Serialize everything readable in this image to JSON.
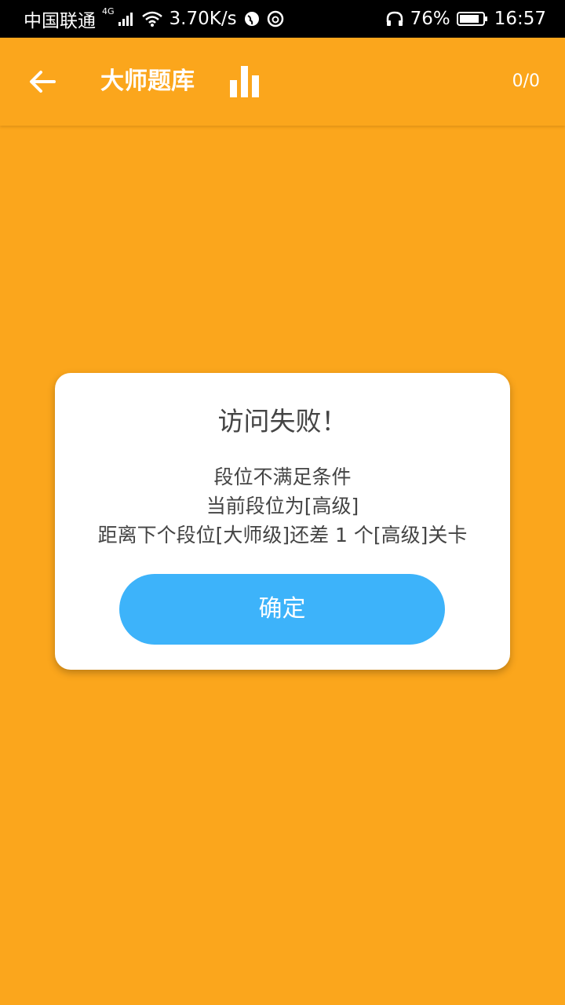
{
  "status_bar": {
    "carrier": "中国联通",
    "network": "4G",
    "speed": "3.70K/s",
    "battery": "76%",
    "time": "16:57"
  },
  "app_bar": {
    "title": "大师题库",
    "progress": "0/0"
  },
  "dialog": {
    "title": "访问失败！",
    "lines": [
      "段位不满足条件",
      "当前段位为[高级]",
      "距离下个段位[大师级]还差 1 个[高级]关卡"
    ],
    "confirm_label": "确定"
  },
  "colors": {
    "background": "#FBA61C",
    "button": "#3DB3FA",
    "dialog_bg": "#FFFFFF",
    "text": "#444444"
  }
}
